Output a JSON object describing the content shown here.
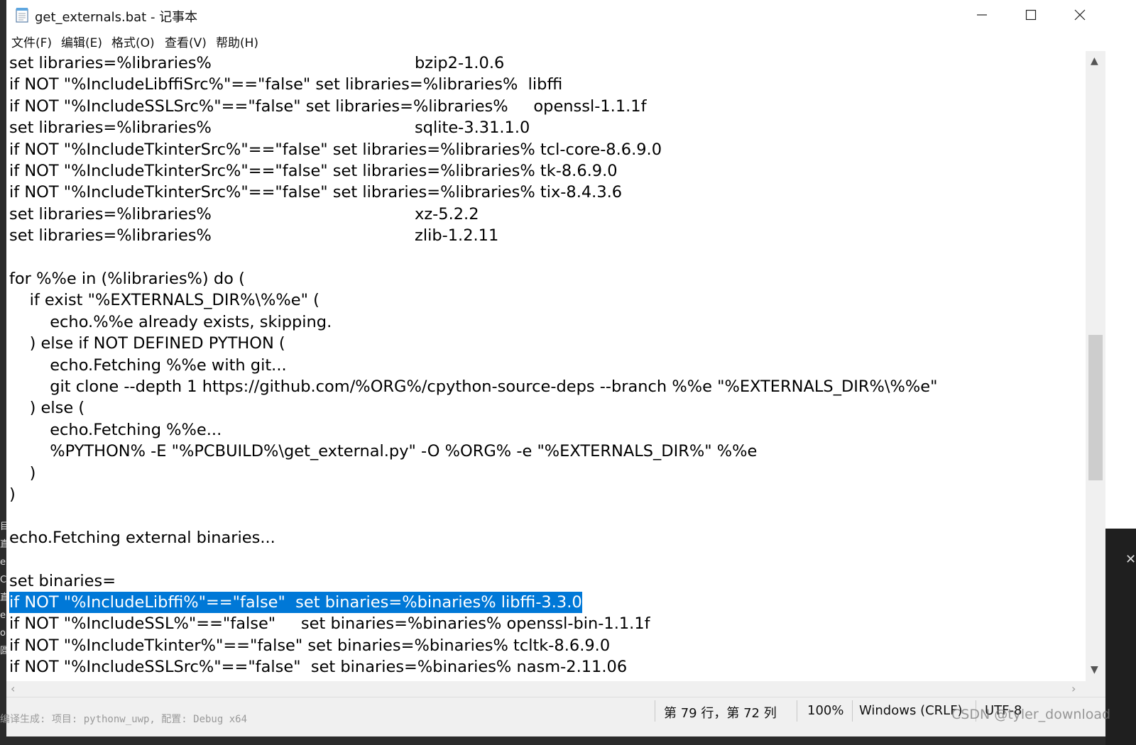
{
  "window": {
    "title": "get_externals.bat - 记事本",
    "icons": {
      "app": "notepad-icon",
      "minimize": "minimize-icon",
      "maximize": "maximize-icon",
      "close": "close-icon"
    }
  },
  "menu": [
    "文件(F)",
    "编辑(E)",
    "格式(O)",
    "查看(V)",
    "帮助(H)"
  ],
  "editor": {
    "lines": [
      "set libraries=%libraries%                                        bzip2-1.0.6",
      "if NOT \"%IncludeLibffiSrc%\"==\"false\" set libraries=%libraries%  libffi",
      "if NOT \"%IncludeSSLSrc%\"==\"false\" set libraries=%libraries%     openssl-1.1.1f",
      "set libraries=%libraries%                                        sqlite-3.31.1.0",
      "if NOT \"%IncludeTkinterSrc%\"==\"false\" set libraries=%libraries% tcl-core-8.6.9.0",
      "if NOT \"%IncludeTkinterSrc%\"==\"false\" set libraries=%libraries% tk-8.6.9.0",
      "if NOT \"%IncludeTkinterSrc%\"==\"false\" set libraries=%libraries% tix-8.4.3.6",
      "set libraries=%libraries%                                        xz-5.2.2",
      "set libraries=%libraries%                                        zlib-1.2.11",
      "",
      "for %%e in (%libraries%) do (",
      "    if exist \"%EXTERNALS_DIR%\\%%e\" (",
      "        echo.%%e already exists, skipping.",
      "    ) else if NOT DEFINED PYTHON (",
      "        echo.Fetching %%e with git...",
      "        git clone --depth 1 https://github.com/%ORG%/cpython-source-deps --branch %%e \"%EXTERNALS_DIR%\\%%e\"",
      "    ) else (",
      "        echo.Fetching %%e...",
      "        %PYTHON% -E \"%PCBUILD%\\get_external.py\" -O %ORG% -e \"%EXTERNALS_DIR%\" %%e",
      "    )",
      ")",
      "",
      "echo.Fetching external binaries...",
      "",
      "set binaries=",
      "if NOT \"%IncludeLibffi%\"==\"false\"  set binaries=%binaries% libffi-3.3.0",
      "if NOT \"%IncludeSSL%\"==\"false\"     set binaries=%binaries% openssl-bin-1.1.1f",
      "if NOT \"%IncludeTkinter%\"==\"false\" set binaries=%binaries% tcltk-8.6.9.0",
      "if NOT \"%IncludeSSLSrc%\"==\"false\"  set binaries=%binaries% nasm-2.11.06"
    ],
    "selected_line_index": 25,
    "selection_color": "#0078d7"
  },
  "statusbar": {
    "position": "第 79 行，第 72 列",
    "zoom": "100%",
    "line_ending": "Windows (CRLF)",
    "encoding": "UTF-8"
  },
  "watermark": "CSDN @tyler_download",
  "background": {
    "left_edge_glyphs": [
      "目",
      "",
      "",
      "",
      "",
      "",
      "直",
      "e",
      "C",
      "直",
      "",
      "e",
      "o",
      "圓"
    ],
    "bottom_leak_text": "编译生成: 项目: pythonw_uwp, 配置: Debug x64",
    "right_close_glyph": "✕"
  }
}
